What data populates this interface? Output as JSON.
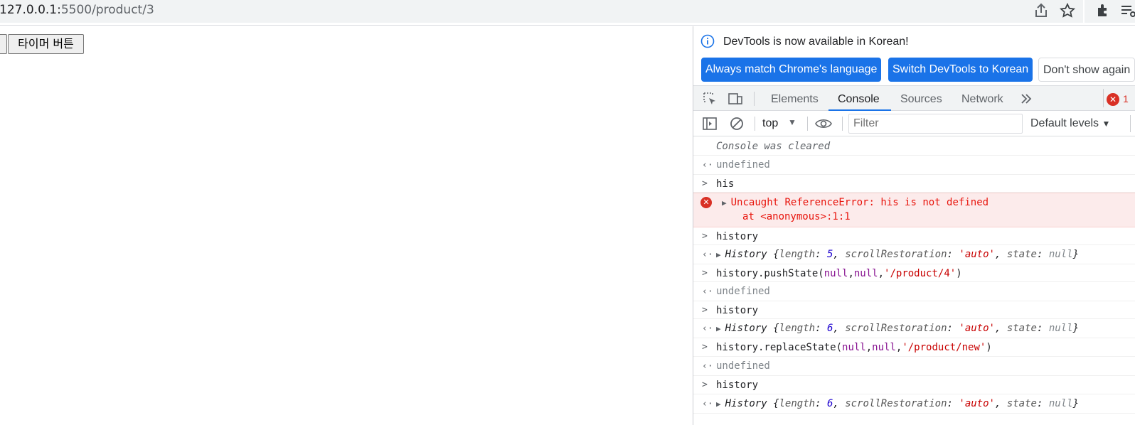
{
  "browser": {
    "url_host": "127.0.0.1:",
    "url_path": "5500/product/3"
  },
  "page": {
    "left_button_label": "",
    "timer_button_label": "타이머 버튼"
  },
  "devtools": {
    "info_message": "DevTools is now available in Korean!",
    "btn_match": "Always match Chrome's language",
    "btn_switch": "Switch DevTools to Korean",
    "btn_dont_show": "Don't show again",
    "tabs": [
      "Elements",
      "Console",
      "Sources",
      "Network"
    ],
    "active_tab": "Console",
    "error_count": "1",
    "context": "top",
    "filter_placeholder": "Filter",
    "levels": "Default levels"
  },
  "console": {
    "cleared": "Console was cleared",
    "undefined": "undefined",
    "in_his": "his",
    "error_msg": "Uncaught ReferenceError: his is not defined",
    "error_at": "at <anonymous>:1:1",
    "in_history": "history",
    "hist_obj_name": "History",
    "len_key": "length",
    "len_val_1": "5",
    "len_val_2": "6",
    "sr_key": "scrollRestoration",
    "sr_val": "'auto'",
    "state_key": "state",
    "null": "null",
    "push_fn": "history.pushState(",
    "push_url": "'/product/4'",
    "replace_fn": "history.replaceState(",
    "replace_url": "'/product/new'"
  },
  "colors": {
    "accent": "#1a73e8",
    "error": "#d93025"
  }
}
